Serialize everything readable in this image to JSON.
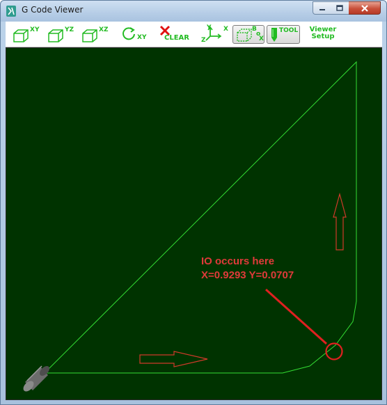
{
  "window": {
    "title": "G Code Viewer",
    "controls": [
      "minimize",
      "maximize",
      "close"
    ]
  },
  "toolbar": {
    "view_xy_label": "XY",
    "view_yz_label": "YZ",
    "view_xz_label": "XZ",
    "rotate_xy_label": "XY",
    "clear_label": "CLEAR",
    "axes_labels": {
      "y": "Y",
      "x": "X",
      "z": "Z"
    },
    "box_labels": {
      "b": "B",
      "o": "o",
      "x": "X"
    },
    "tool_label": "TOOL",
    "viewer_setup_line1": "Viewer",
    "viewer_setup_line2": "Setup",
    "box_toggle_active": true,
    "tool_toggle_active": true,
    "accent_color": "#22bb22"
  },
  "viewport": {
    "background_color": "#003300",
    "toolpath_color": "#33dd33",
    "annotation_color": "#e03a3a",
    "annotation_line1": "IO occurs here",
    "annotation_line2": "X=0.9293 Y=0.0707",
    "icons": [
      "tool-cylinder-icon",
      "right-arrow-icon",
      "up-arrow-icon",
      "highlight-circle-icon",
      "pointer-line-icon"
    ]
  }
}
